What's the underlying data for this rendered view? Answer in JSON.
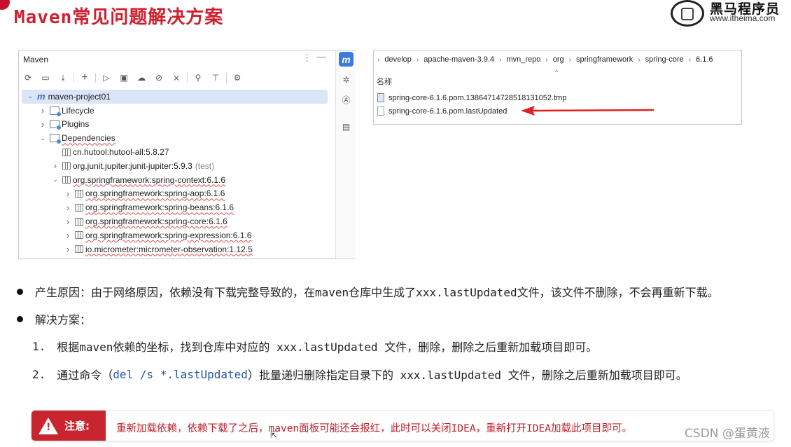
{
  "header": {
    "title": "Maven常见问题解决方案",
    "logo_cn": "黑马程序员",
    "logo_url": "www.itheima.com"
  },
  "maven_panel": {
    "title": "Maven",
    "tree": [
      {
        "label": "maven-project01",
        "icon": "maven-m-icon",
        "indent": 0,
        "arrow": "expanded",
        "selected": true
      },
      {
        "label": "Lifecycle",
        "icon": "folder-icon",
        "indent": 1,
        "arrow": "collapsed"
      },
      {
        "label": "Plugins",
        "icon": "folder-icon",
        "indent": 1,
        "arrow": "collapsed"
      },
      {
        "label": "Dependencies",
        "icon": "folder-icon",
        "indent": 1,
        "arrow": "expanded",
        "wavy": true
      },
      {
        "label": "cn.hutool:hutool-all:5.8.27",
        "icon": "library-icon",
        "indent": 2,
        "arrow": "none"
      },
      {
        "label": "org.junit.jupiter:junit-jupiter:5.9.3",
        "suffix": "(test)",
        "icon": "library-icon",
        "indent": 2,
        "arrow": "collapsed"
      },
      {
        "label": "org.springframework:spring-context:6.1.6",
        "icon": "library-icon",
        "indent": 2,
        "arrow": "expanded",
        "wavy": true
      },
      {
        "label": "org.springframework:spring-aop:6.1.6",
        "icon": "library-icon",
        "indent": 3,
        "arrow": "collapsed",
        "wavy": true
      },
      {
        "label": "org.springframework:spring-beans:6.1.6",
        "icon": "library-icon",
        "indent": 3,
        "arrow": "collapsed",
        "wavy": true
      },
      {
        "label": "org.springframework:spring-core:6.1.6",
        "icon": "library-icon",
        "indent": 3,
        "arrow": "collapsed",
        "wavy": true
      },
      {
        "label": "org.springframework:spring-expression:6.1.6",
        "icon": "library-icon",
        "indent": 3,
        "arrow": "collapsed",
        "wavy": true
      },
      {
        "label": "io.micrometer:micrometer-observation:1.12.5",
        "icon": "library-icon",
        "indent": 3,
        "arrow": "collapsed",
        "wavy": true
      }
    ]
  },
  "explorer": {
    "breadcrumb": [
      "develop",
      "apache-maven-3.9.4",
      "mvn_repo",
      "org",
      "springframework",
      "spring-core",
      "6.1.6"
    ],
    "column_name": "名称",
    "files": [
      {
        "name": "spring-core-6.1.6.pom.13864714728518131052.tmp",
        "icon": "tmp-file-icon"
      },
      {
        "name": "spring-core-6.1.6.pom.lastUpdated",
        "icon": "file-icon"
      }
    ]
  },
  "content": {
    "reason_label": "产生原因：",
    "reason_text": "由于网络原因，依赖没有下载完整导致的，在maven仓库中生成了xxx.lastUpdated文件，该文件不删除，不会再重新下载。",
    "solution_label": "解决方案：",
    "step1_num": "1.",
    "step1_text": "根据maven依赖的坐标，找到仓库中对应的 xxx.lastUpdated 文件，删除，删除之后重新加载项目即可。",
    "step2_num": "2.",
    "step2_pre": "通过命令（",
    "step2_cmd": "del /s *.lastUpdated",
    "step2_post": "）批量递归删除指定目录下的 xxx.lastUpdated 文件，删除之后重新加载项目即可。"
  },
  "note": {
    "tag": "注意:",
    "text": "重新加载依赖，依赖下载了之后，maven面板可能还会报红，此时可以关闭IDEA，重新打开IDEA加载此项目即可。"
  },
  "watermark": "CSDN @蛋黄液",
  "colors": {
    "title_red": "#d01f2e",
    "note_red": "#c9252f",
    "selection": "#dbe5f7",
    "maven_blue": "#3b7be0"
  }
}
